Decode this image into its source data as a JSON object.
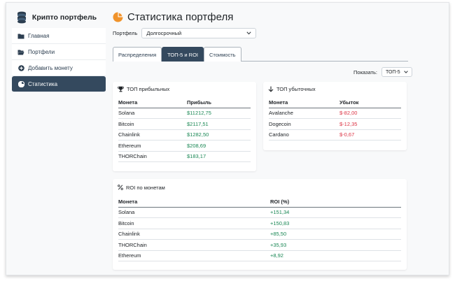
{
  "brand": {
    "title": "Крипто портфель"
  },
  "sidebar": {
    "items": [
      {
        "label": "Главная",
        "icon": "folder-icon"
      },
      {
        "label": "Портфели",
        "icon": "folder-open-icon"
      },
      {
        "label": "Добавить монету",
        "icon": "plus-circle-icon"
      },
      {
        "label": "Статистика",
        "icon": "chart-icon",
        "active": true
      }
    ]
  },
  "header": {
    "title": "Статистика портфеля"
  },
  "portfolio": {
    "label": "Портфель",
    "selected": "Долгосрочный"
  },
  "tabs": [
    {
      "label": "Распределения",
      "active": false
    },
    {
      "label": "ТОП-5 и ROI",
      "active": true
    },
    {
      "label": "Стоимость",
      "active": false
    }
  ],
  "show": {
    "label": "Показать:",
    "selected": "ТОП-5"
  },
  "top_profit": {
    "title": "ТОП прибыльных",
    "col_coin": "Монета",
    "col_value": "Прибыль",
    "rows": [
      {
        "coin": "Solana",
        "value": "$11212,75"
      },
      {
        "coin": "Bitcoin",
        "value": "$2117,51"
      },
      {
        "coin": "Chainlink",
        "value": "$1282,50"
      },
      {
        "coin": "Ethereum",
        "value": "$208,69"
      },
      {
        "coin": "THORChain",
        "value": "$183,17"
      }
    ]
  },
  "top_loss": {
    "title": "ТОП убыточных",
    "col_coin": "Монета",
    "col_value": "Убыток",
    "rows": [
      {
        "coin": "Avalanche",
        "value": "$-82,00"
      },
      {
        "coin": "Dogecoin",
        "value": "$-12,35"
      },
      {
        "coin": "Cardano",
        "value": "$-0,67"
      }
    ]
  },
  "roi": {
    "title": "ROI по монетам",
    "col_coin": "Монета",
    "col_value": "ROI (%)",
    "rows": [
      {
        "coin": "Solana",
        "value": "+151,34"
      },
      {
        "coin": "Bitcoin",
        "value": "+150,83"
      },
      {
        "coin": "Chainlink",
        "value": "+85,50"
      },
      {
        "coin": "THORChain",
        "value": "+35,93"
      },
      {
        "coin": "Ethereum",
        "value": "+8,92"
      }
    ]
  },
  "colors": {
    "accent": "#34495e",
    "profit": "#198754",
    "loss": "#dc3545",
    "title_icon": "#f0932b"
  }
}
